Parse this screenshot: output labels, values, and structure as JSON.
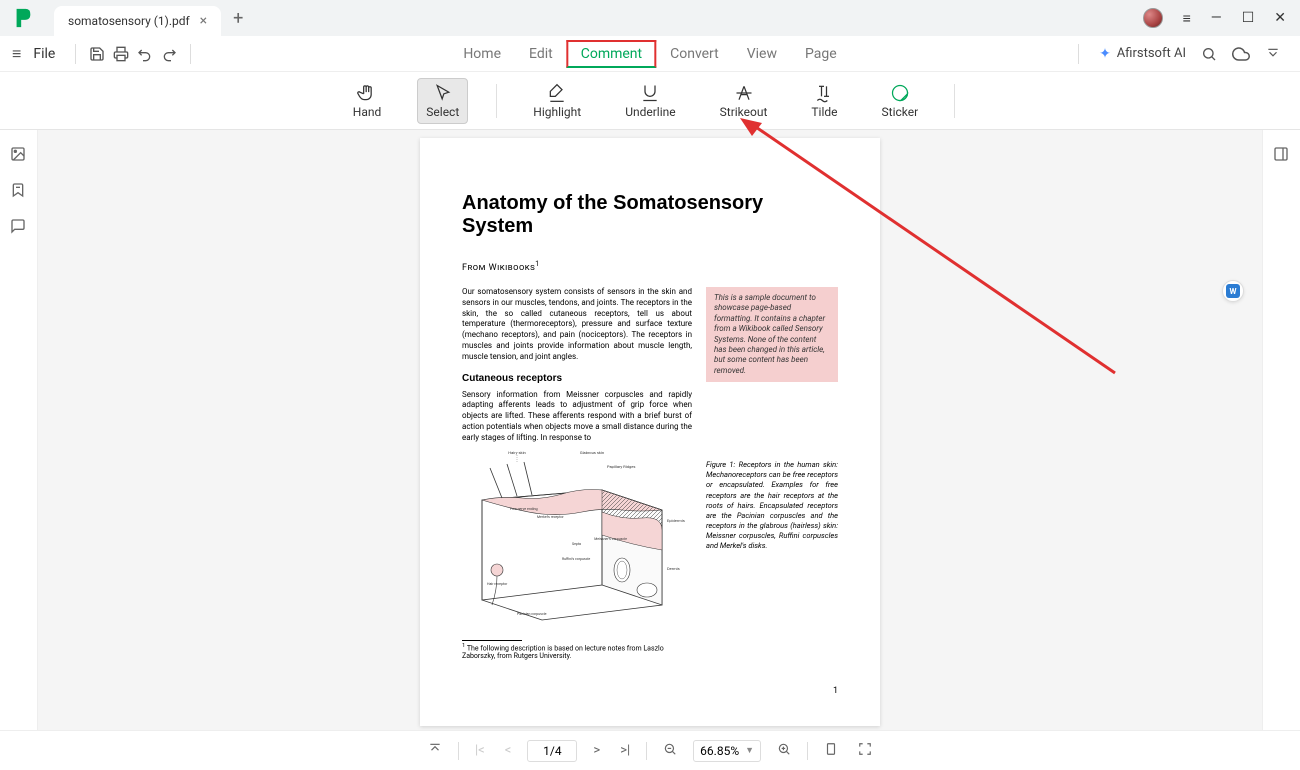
{
  "tab": {
    "title": "somatosensory (1).pdf"
  },
  "menubar": {
    "file": "File",
    "items": [
      "Home",
      "Edit",
      "Comment",
      "Convert",
      "View",
      "Page"
    ],
    "active_index": 2,
    "ai_label": "Afirstsoft AI"
  },
  "toolbar": {
    "tools": [
      {
        "name": "hand",
        "label": "Hand"
      },
      {
        "name": "select",
        "label": "Select",
        "selected": true
      },
      {
        "name": "highlight",
        "label": "Highlight"
      },
      {
        "name": "underline",
        "label": "Underline"
      },
      {
        "name": "strikeout",
        "label": "Strikeout"
      },
      {
        "name": "tilde",
        "label": "Tilde"
      },
      {
        "name": "sticker",
        "label": "Sticker"
      }
    ]
  },
  "document": {
    "title": "Anatomy of the Somatosensory System",
    "source_label": "From Wikibooks",
    "source_sup": "1",
    "para1": "Our somatosensory system consists of sensors in the skin and sensors in our muscles, tendons, and joints. The receptors in the skin, the so called cutaneous receptors, tell us about temperature (thermoreceptors), pressure and surface texture (mechano receptors), and pain (nociceptors). The receptors in muscles and joints provide information about muscle length, muscle tension, and joint angles.",
    "pinkbox": "This is a sample document to showcase page-based formatting. It contains a chapter from a Wikibook called Sensory Systems. None of the content has been changed in this article, but some content has been removed.",
    "subhead": "Cutaneous receptors",
    "para2": "Sensory information from Meissner corpuscles and rapidly adapting afferents leads to adjustment of grip force when objects are lifted. These afferents respond with a brief burst of action potentials when objects move a small distance during the early stages of lifting. In response to",
    "figcaption": "Figure 1: Receptors in the human skin: Mechanoreceptors can be free receptors or encapsulated. Examples for free receptors are the hair receptors at the roots of hairs. Encapsulated receptors are the Pacinian corpuscles and the receptors in the glabrous (hairless) skin: Meissner corpuscles, Ruffini corpuscles and Merkel's disks.",
    "footnote_sup": "1",
    "footnote": " The following description is based on lecture notes from Laszlo Zaborszky, from Rutgers University.",
    "page_num": "1",
    "fig_labels": {
      "hairy": "Hairy skin",
      "glabrous": "Glabrous skin",
      "papillary": "Papillary Ridges",
      "epidermis": "Epidermis",
      "dermis": "Dermis",
      "freenerve": "Free nerve ending",
      "merkel": "Merkel's receptor",
      "meissner": "Meissner's corpuscle",
      "ruffini": "Ruffini's corpuscle",
      "hairrecept": "Hair receptor",
      "pacinian": "Pacinian corpuscle",
      "septa": "Septa"
    }
  },
  "bottombar": {
    "page_current": "1/4",
    "zoom": "66.85%"
  }
}
